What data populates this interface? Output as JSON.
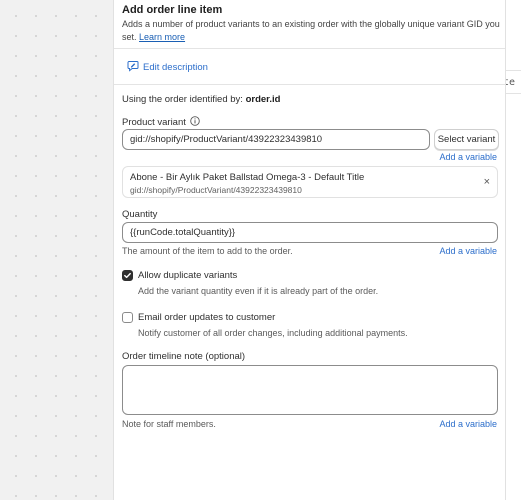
{
  "background": {
    "code_snippet": "te c"
  },
  "header": {
    "title": "Add order line item",
    "description": "Adds a number of product variants to an existing order with the globally unique variant GID you set.",
    "learn_more": "Learn more"
  },
  "edit_description": {
    "label": "Edit description",
    "icon": "pencil-speech-bubble-icon"
  },
  "order": {
    "prefix": "Using the order identified by:",
    "value": "order.id"
  },
  "product_variant": {
    "label": "Product variant",
    "info_icon": "info-icon",
    "value": "gid://shopify/ProductVariant/43922323439810",
    "select_button": "Select variant",
    "add_variable": "Add a variable",
    "selected": {
      "title": "Abone - Bir Aylık Paket Ballstad Omega-3 - Default Title",
      "gid": "gid://shopify/ProductVariant/43922323439810"
    }
  },
  "quantity": {
    "label": "Quantity",
    "value": "{{runCode.totalQuantity}}",
    "help": "The amount of the item to add to the order.",
    "add_variable": "Add a variable"
  },
  "allow_duplicates": {
    "checked": true,
    "label": "Allow duplicate variants",
    "help": "Add the variant quantity even if it is already part of the order."
  },
  "email_updates": {
    "checked": false,
    "label": "Email order updates to customer",
    "help": "Notify customer of all order changes, including additional payments."
  },
  "timeline_note": {
    "label": "Order timeline note (optional)",
    "value": "",
    "help": "Note for staff members.",
    "add_variable": "Add a variable"
  },
  "colors": {
    "link": "#2c6ecb",
    "border": "#8c8c8c",
    "checkbox_on": "#303030"
  }
}
